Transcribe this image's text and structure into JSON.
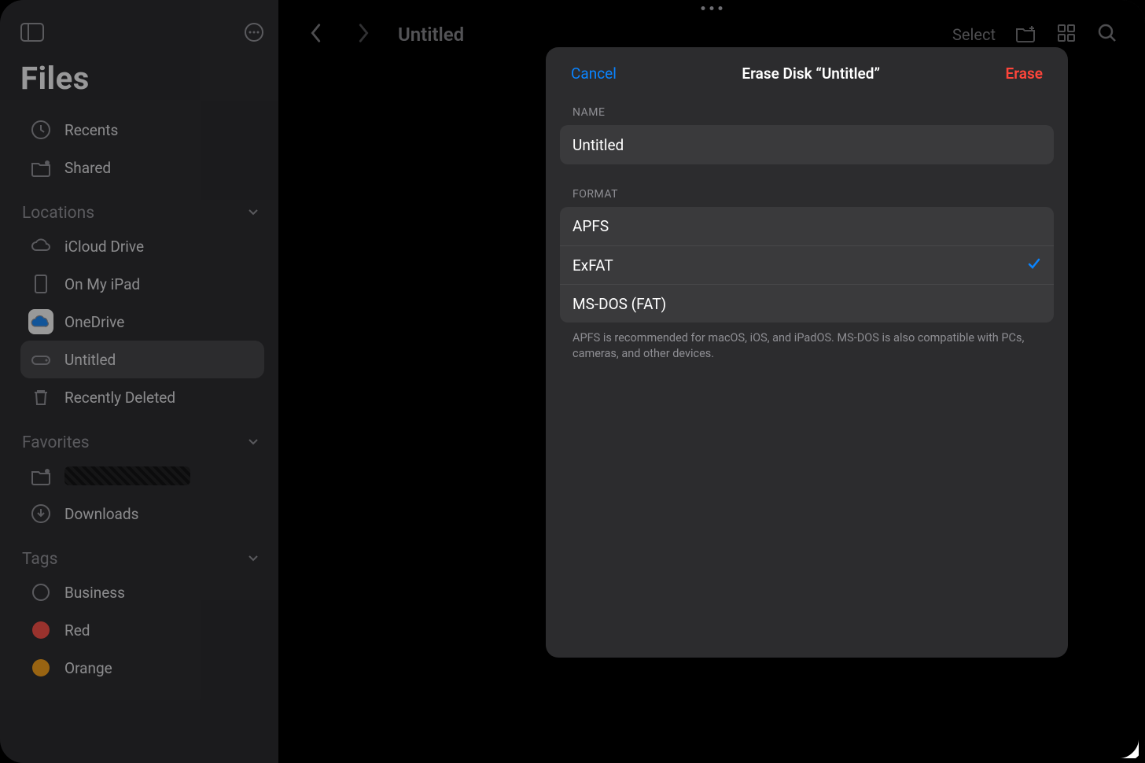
{
  "sidebar": {
    "title": "Files",
    "items_top": [
      {
        "label": "Recents",
        "icon": "clock"
      },
      {
        "label": "Shared",
        "icon": "folder-person"
      }
    ],
    "sections": [
      {
        "header": "Locations",
        "items": [
          {
            "label": "iCloud Drive",
            "icon": "cloud"
          },
          {
            "label": "On My iPad",
            "icon": "ipad"
          },
          {
            "label": "OneDrive",
            "icon": "onedrive"
          },
          {
            "label": "Untitled",
            "icon": "drive",
            "selected": true
          },
          {
            "label": "Recently Deleted",
            "icon": "trash"
          }
        ]
      },
      {
        "header": "Favorites",
        "items": [
          {
            "label": "",
            "icon": "folder-person",
            "redacted": true
          },
          {
            "label": "Downloads",
            "icon": "download-circle"
          }
        ]
      },
      {
        "header": "Tags",
        "items": [
          {
            "label": "Business",
            "tag_color": "outline"
          },
          {
            "label": "Red",
            "tag_color": "#ff453a"
          },
          {
            "label": "Orange",
            "tag_color": "#ff9f0a"
          }
        ]
      }
    ]
  },
  "topbar": {
    "title": "Untitled",
    "select_label": "Select"
  },
  "dialog": {
    "cancel_label": "Cancel",
    "title": "Erase Disk “Untitled”",
    "erase_label": "Erase",
    "name_label": "NAME",
    "name_value": "Untitled",
    "format_label": "FORMAT",
    "formats": [
      {
        "label": "APFS",
        "selected": false
      },
      {
        "label": "ExFAT",
        "selected": true
      },
      {
        "label": "MS-DOS (FAT)",
        "selected": false
      }
    ],
    "help_text": "APFS is recommended for macOS, iOS, and iPadOS. MS-DOS is also compatible with PCs, cameras, and other devices."
  }
}
